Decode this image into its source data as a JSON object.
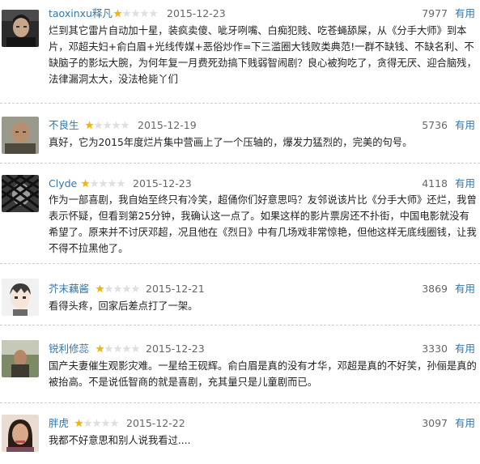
{
  "rating_colors": {
    "filled": "#f5b50a",
    "empty": "#e0e0e0"
  },
  "useful_label": "有用",
  "reviews": [
    {
      "name": "taoxinxu释凡",
      "avatar_icon": "man-dark-portrait-avatar",
      "stars": 1,
      "date": "2015-12-23",
      "votes": "7977",
      "content": "烂到其它雷片自动加十星，装疯卖傻、呲牙咧嘴、白痴犯贱、吃苍蝇舔屎，从《分手大师》到本片，邓超夫妇+俞白眉+光线传媒+恶俗炒作=下三滥圈大钱败类典范!一群不缺钱、不缺名利、不缺脑子的影坛大腕，为何年复一月费死劲搞下贱弱智闹剧？良心被狗吃了，贪得无厌、迎合脑残，法律漏洞太大，没法枪毙丫们"
    },
    {
      "name": "不良生",
      "avatar_icon": "man-bald-portrait-avatar",
      "stars": 1,
      "date": "2015-12-19",
      "votes": "5736",
      "content": "真好，它为2015年度烂片集中营画上了一个压轴的，爆发力猛烈的，完美的句号。"
    },
    {
      "name": "Clyde",
      "avatar_icon": "man-behind-fence-avatar",
      "stars": 1,
      "date": "2015-12-23",
      "votes": "4118",
      "content": "作为一部喜剧，我自始至终只有冷笑，超俑你们好意思吗？友邻说该片比《分手大师》还烂，我曾表示怀疑，但看到第25分钟，我确认这一点了。如果这样的影片票房还不扑街，中国电影就没有希望了。原来并不讨厌邓超，况且他在《烈日》中有几场戏非常惊艳，但他这样无底线圈钱，让我不得不拉黑他了。"
    },
    {
      "name": "芥末藕酱",
      "avatar_icon": "anime-boy-avatar",
      "stars": 1,
      "date": "2015-12-21",
      "votes": "3869",
      "content": "看得头疼，回家后差点打了一架。"
    },
    {
      "name": "锐利修蕊",
      "avatar_icon": "person-outdoor-avatar",
      "stars": 1,
      "date": "2015-12-23",
      "votes": "3330",
      "content": "国产夫妻催生观影灾难。一星给王砚辉。俞白眉是真的没有才华，邓超是真的不好笑，孙俪是真的被抬高。不是说低智商的就是喜剧，充其量只是儿童剧而已。"
    },
    {
      "name": "胖虎",
      "avatar_icon": "woman-portrait-avatar",
      "stars": 1,
      "date": "2015-12-22",
      "votes": "3097",
      "content": "我都不好意思和别人说我看过...."
    }
  ]
}
